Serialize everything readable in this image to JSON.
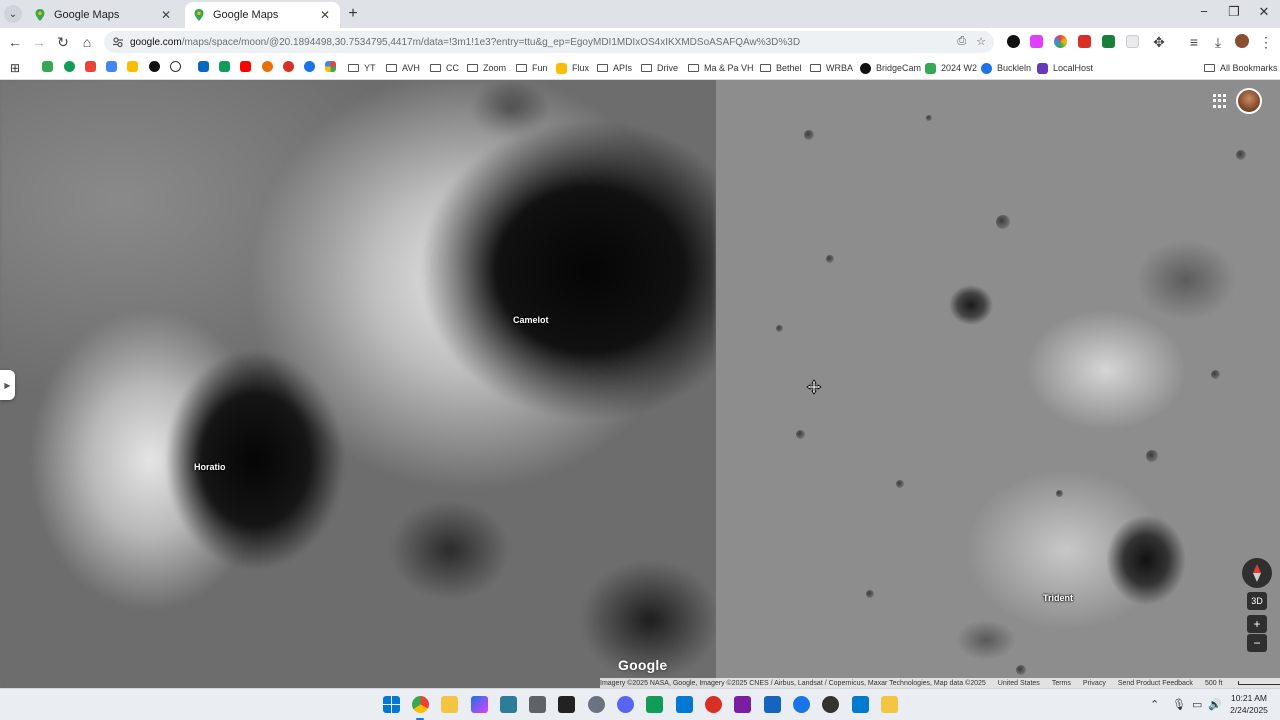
{
  "browser": {
    "tabs": [
      {
        "title": "Google Maps",
        "active": false
      },
      {
        "title": "Google Maps",
        "active": true
      }
    ],
    "url_host": "google.com",
    "url_path": "/maps/space/moon/@20.1894498,30.7534795,4417m/data=!3m1!1e3?entry=ttu&g_ep=EgoyMDI1MDIxOS4xIKXMDSoASAFQAw%3D%3D",
    "bookmarks": [
      "YT",
      "AVH",
      "CC",
      "Zoom",
      "Fun",
      "Flux",
      "APIs",
      "Drive",
      "Ma & Pa VH",
      "Bethel",
      "WRBA",
      "BridgeCam",
      "2024 W2",
      "Buckleln",
      "LocalHost"
    ],
    "all_bookmarks": "All Bookmarks"
  },
  "map": {
    "labels": {
      "camelot": "Camelot",
      "horatio": "Horatio",
      "trident": "Trident"
    },
    "logo": "Google",
    "attribution": "Imagery ©2025 NASA, Google, Imagery ©2025 CNES / Airbus, Landsat / Copernicus, Maxar Technologies, Map data ©2025",
    "footer_links": [
      "United States",
      "Terms",
      "Privacy",
      "Send Product Feedback"
    ],
    "scale": "500 ft",
    "mode_3d": "3D",
    "zoom_in": "+",
    "zoom_out": "−"
  },
  "taskbar": {
    "time": "10:21 AM",
    "date": "2/24/2025"
  },
  "icons": {
    "tab_favicon": "google-maps-pin-icon",
    "back": "back-arrow-icon",
    "forward": "forward-arrow-icon",
    "reload": "reload-icon",
    "home": "home-icon",
    "apps": "apps-grid-icon",
    "compass": "compass-icon"
  },
  "colors": {
    "accent": "#1a73e8",
    "chrome_bg": "#dfe3e8"
  }
}
